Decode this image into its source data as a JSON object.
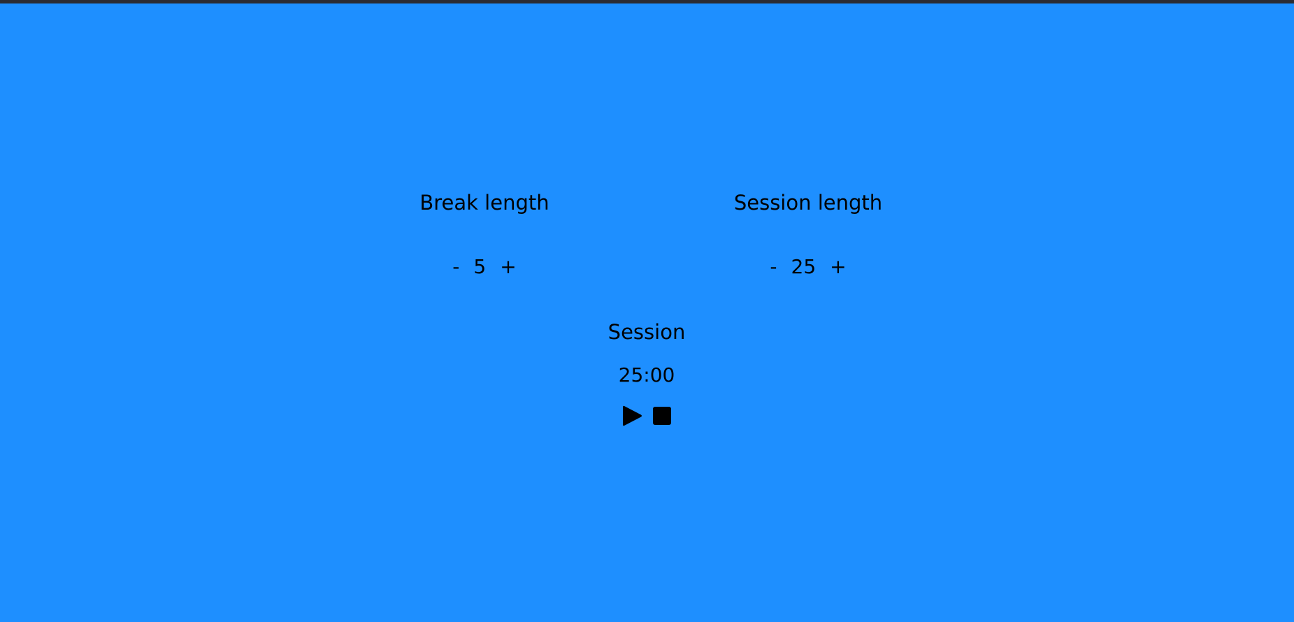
{
  "break": {
    "title": "Break length",
    "decrement_label": "-",
    "value": "5",
    "increment_label": "+"
  },
  "session": {
    "title": "Session length",
    "decrement_label": "-",
    "value": "25",
    "increment_label": "+"
  },
  "timer": {
    "label": "Session",
    "display": "25:00"
  },
  "playback": {
    "play_icon": "play-icon",
    "stop_icon": "stop-icon"
  },
  "colors": {
    "background": "#1e8fff",
    "top_bar": "#2b2b33",
    "text": "#000000"
  }
}
